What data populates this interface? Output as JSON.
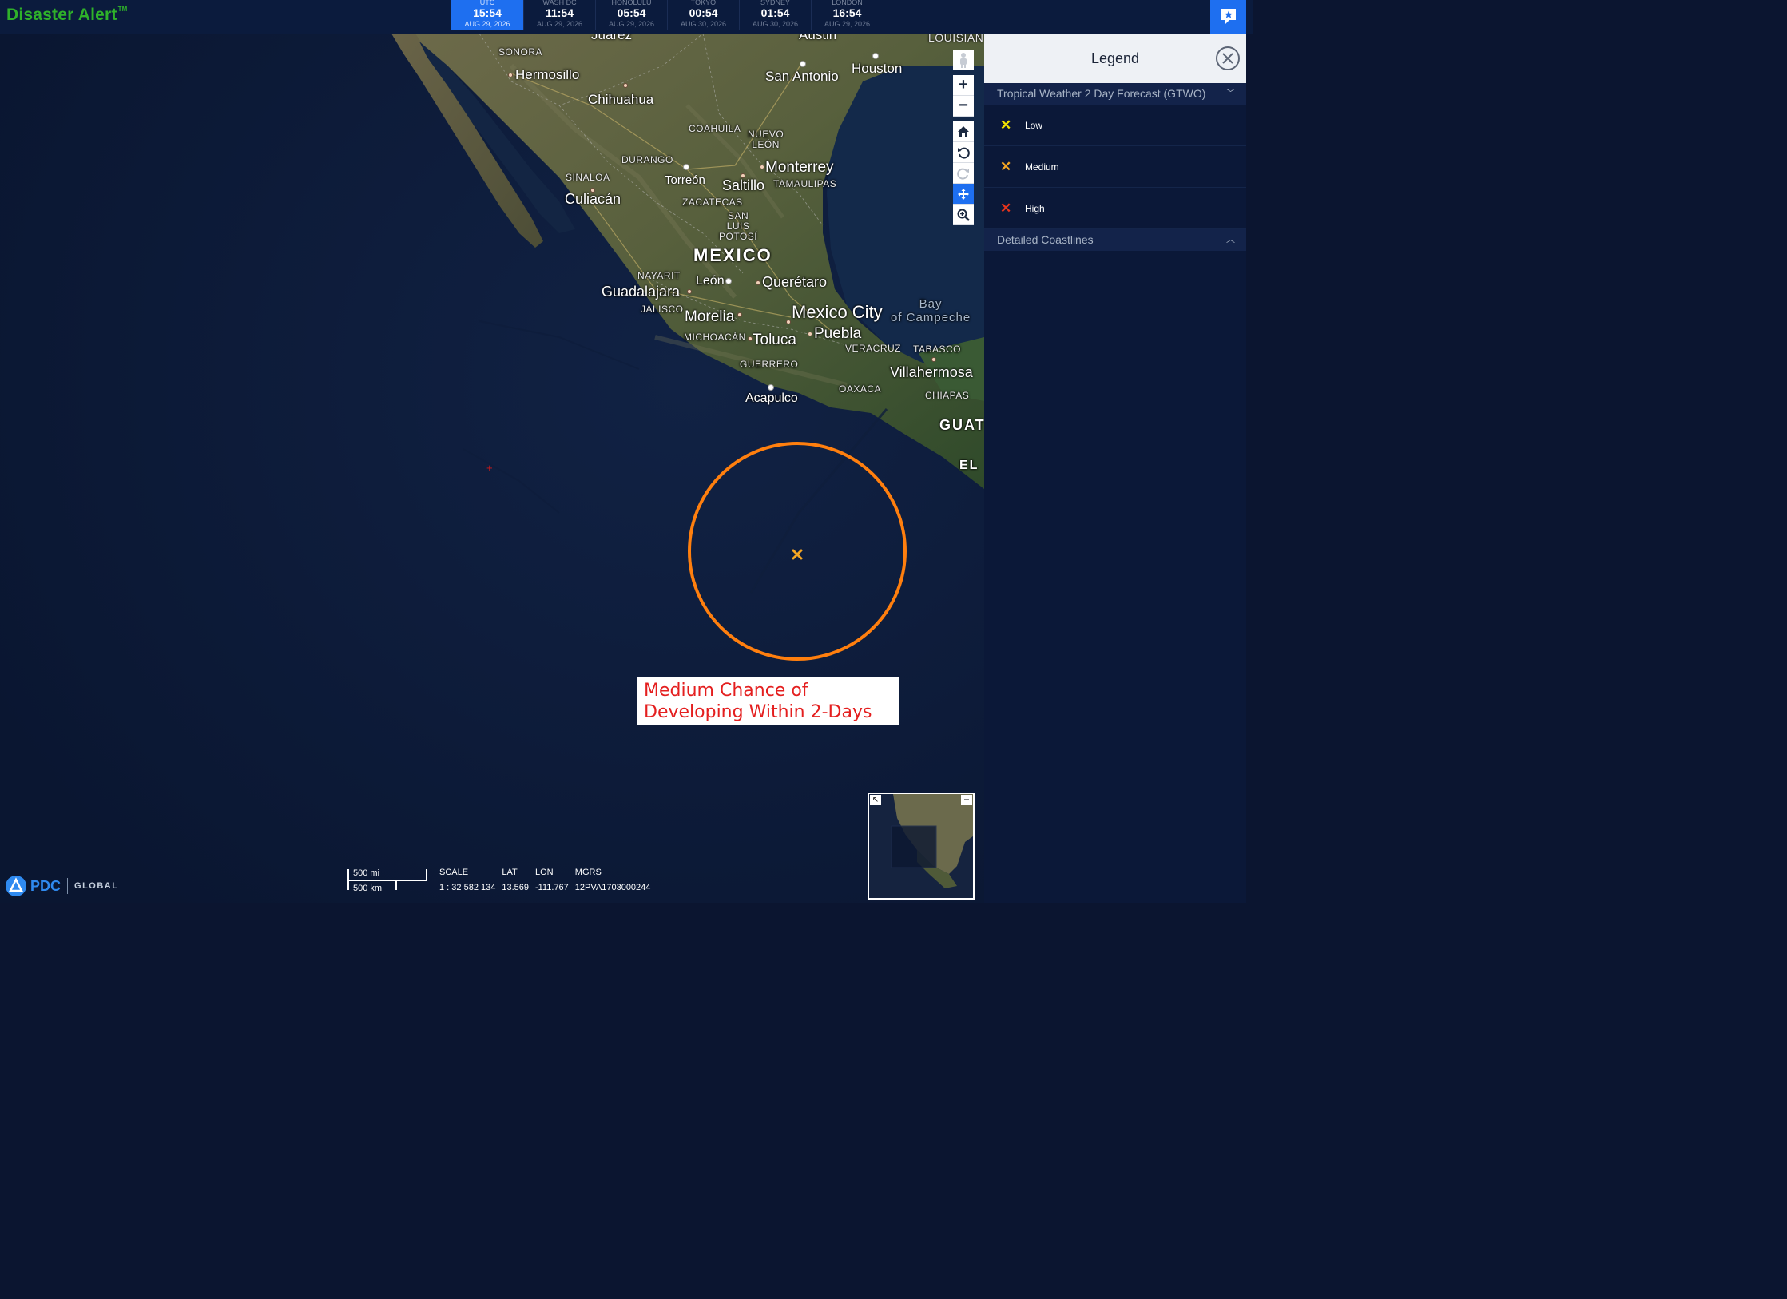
{
  "app": {
    "name": "Disaster Alert",
    "trademark": "TM"
  },
  "clocks": [
    {
      "city": "UTC",
      "time": "15:54",
      "date": "AUG 29, 2026",
      "active": true
    },
    {
      "city": "WASH DC",
      "time": "11:54",
      "date": "AUG 29, 2026"
    },
    {
      "city": "HONOLULU",
      "time": "05:54",
      "date": "AUG 29, 2026"
    },
    {
      "city": "TOKYO",
      "time": "00:54",
      "date": "AUG 30, 2026"
    },
    {
      "city": "SYDNEY",
      "time": "01:54",
      "date": "AUG 30, 2026"
    },
    {
      "city": "LONDON",
      "time": "16:54",
      "date": "AUG 29, 2026"
    }
  ],
  "header": {
    "alerts_icon": "star-flag-icon",
    "accent_color": "#1e6ff0",
    "brand_color": "#2fb12a"
  },
  "map": {
    "labels": {
      "juarez": "Juarez",
      "austin": "Austin",
      "louisiana": "LOUISIAN",
      "sonora": "SONORA",
      "hermosillo": "Hermosillo",
      "chihuahua": "Chihuahua",
      "san_antonio": "San Antonio",
      "houston": "Houston",
      "coahuila": "COAHUILA",
      "nuevo_leon": "NUEVO\nLEÓN",
      "durango": "DURANGO",
      "monterrey": "Monterrey",
      "sinaloa": "SINALOA",
      "torreon": "Torreón",
      "saltillo": "Saltillo",
      "tamaulipas": "TAMAULIPAS",
      "culiacan": "Culiacán",
      "zacatecas": "ZACATECAS",
      "san_luis_potosi": "SAN\nLUIS\nPOTOSÍ",
      "mexico": "MEXICO",
      "nayarit": "NAYARIT",
      "leon": "León",
      "queretaro": "Querétaro",
      "guadalajara": "Guadalajara",
      "jalisco": "JALISCO",
      "mexico_city": "Mexico City",
      "bay_of_campeche": "Bay\nof Campeche",
      "morelia": "Morelia",
      "puebla": "Puebla",
      "michoacan": "MICHOACÁN",
      "toluca": "Toluca",
      "veracruz": "VERACRUZ",
      "tabasco": "TABASCO",
      "guerrero": "GUERRERO",
      "villahermosa": "Villahermosa",
      "oaxaca": "OAXACA",
      "chiapas": "CHIAPAS",
      "acapulco": "Acapulco",
      "guat": "GUAT",
      "el": "EL"
    },
    "storm": {
      "label": "Medium Chance of Developing Within 2-Days",
      "category": "Medium",
      "circle_color": "#ff7f0e",
      "marker_color": "#f5a623"
    },
    "tools": [
      "street-view-icon",
      "zoom-in-icon",
      "zoom-out-icon",
      "home-icon",
      "rotate-left-icon",
      "rotate-right-icon",
      "pan-icon",
      "zoom-box-icon"
    ]
  },
  "footer": {
    "logo": "PDC",
    "logo_suffix": "GLOBAL",
    "scale_mi": "500 mi",
    "scale_km": "500 km",
    "scale_label": "SCALE",
    "scale_value": "1 : 32 582 134",
    "lat_label": "LAT",
    "lat_value": "13.569",
    "lon_label": "LON",
    "lon_value": "-111.767",
    "mgrs_label": "MGRS",
    "mgrs_value": "12PVA1703000244"
  },
  "legend": {
    "title": "Legend",
    "groups": [
      {
        "title": "Tropical Weather 2 Day Forecast (GTWO)",
        "expanded": true,
        "items": [
          {
            "label": "Low",
            "color": "#f2e300"
          },
          {
            "label": "Medium",
            "color": "#f5a623"
          },
          {
            "label": "High",
            "color": "#e8341c"
          }
        ]
      },
      {
        "title": "Detailed Coastlines",
        "expanded": false
      }
    ]
  }
}
